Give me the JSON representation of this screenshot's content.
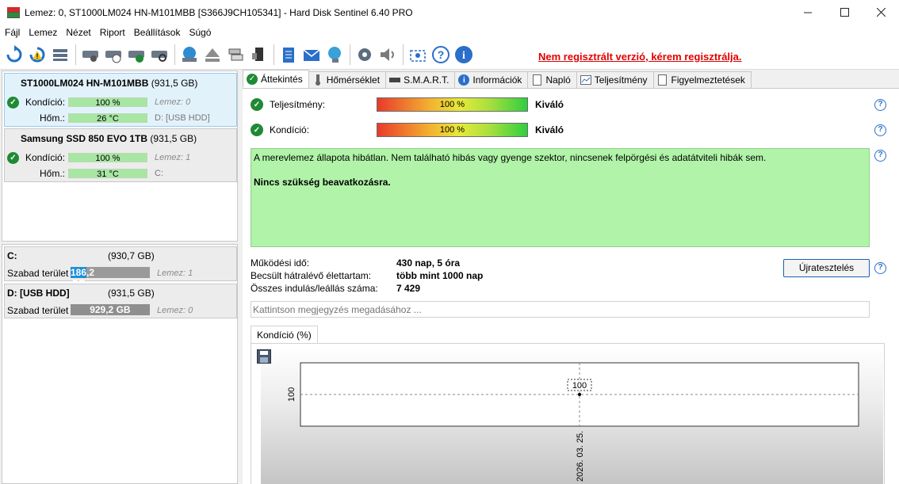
{
  "window": {
    "title": "Lemez: 0, ST1000LM024 HN-M101MBB [S366J9CH105341]  -  Hard Disk Sentinel 6.40 PRO",
    "minimize": "—",
    "maximize": "☐",
    "close": "✕"
  },
  "menu": [
    "Fájl",
    "Lemez",
    "Nézet",
    "Riport",
    "Beállítások",
    "Súgó"
  ],
  "toolbar": {
    "register_text": "Nem regisztrált verzió, kérem regisztrálja."
  },
  "disks": [
    {
      "name": "ST1000LM024 HN-M101MBB",
      "size": "(931,5 GB)",
      "health_label": "Kondíció:",
      "health_value": "100 %",
      "health_note": "Lemez: 0",
      "temp_label": "Hőm.:",
      "temp_value": "26 °C",
      "drive": "D: [USB HDD]"
    },
    {
      "name": "Samsung SSD 850 EVO 1TB",
      "size": "(931,5 GB)",
      "health_label": "Kondíció:",
      "health_value": "100 %",
      "health_note": "Lemez: 1",
      "temp_label": "Hőm.:",
      "temp_value": "31 °C",
      "drive": "C:"
    }
  ],
  "partitions": [
    {
      "name": "C:",
      "size": "(930,7 GB)",
      "free_label": "Szabad terület",
      "free_value": "186,2 GB",
      "free_fraction": 0.2,
      "disk_note": "Lemez: 1",
      "color": "#1e8fd5"
    },
    {
      "name": "D: [USB HDD]",
      "size": "(931,5 GB)",
      "free_label": "Szabad terület",
      "free_value": "929,2 GB",
      "free_fraction": 0.998,
      "disk_note": "Lemez: 0",
      "color": "#8f8f8f"
    }
  ],
  "tabs": [
    "Áttekintés",
    "Hőmérséklet",
    "S.M.A.R.T.",
    "Információk",
    "Napló",
    "Teljesítmény",
    "Figyelmeztetések"
  ],
  "overview": {
    "performance_label": "Teljesítmény:",
    "performance_value": "100 %",
    "performance_rating": "Kiváló",
    "health_label": "Kondíció:",
    "health_value": "100 %",
    "health_rating": "Kiváló",
    "status_text": "A merevlemez állapota hibátlan. Nem található hibás vagy gyenge szektor, nincsenek felpörgési és adatátviteli hibák sem.",
    "action_text": "Nincs szükség beavatkozásra.",
    "uptime_label": "Működési idő:",
    "uptime_value": "430 nap, 5 óra",
    "lifetime_label": "Becsült hátralévő élettartam:",
    "lifetime_value": "több mint 1000 nap",
    "startstop_label": "Összes indulás/leállás száma:",
    "startstop_value": "7 429",
    "retest_button": "Újratesztelés",
    "note_placeholder": "Kattintson megjegyzés megadásához ...",
    "chart_tab": "Kondíció  (%)"
  },
  "chart_data": {
    "type": "line",
    "x": [
      "2026. 03. 25."
    ],
    "series": [
      {
        "values": [
          100
        ]
      }
    ],
    "ytick_labels": [
      "100"
    ],
    "data_labels": [
      "100"
    ],
    "grid": true
  }
}
